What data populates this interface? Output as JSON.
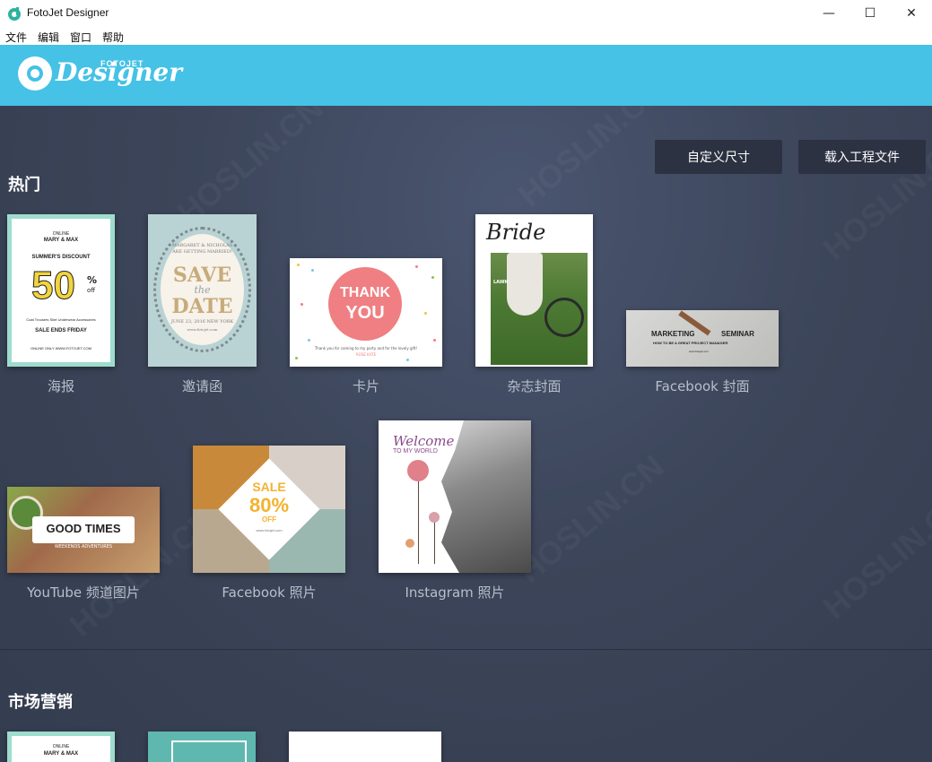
{
  "window": {
    "title": "FotoJet Designer",
    "minimize": "—",
    "maximize": "☐",
    "close": "✕"
  },
  "menu": [
    "文件",
    "编辑",
    "窗口",
    "帮助"
  ],
  "header": {
    "logo_small": "FOTOJET",
    "logo_word": "Designer",
    "bg": "#45c2e6"
  },
  "toolbar": {
    "custom_size": "自定义尺寸",
    "load_project": "载入工程文件"
  },
  "sections": {
    "hot": "热门",
    "marketing": "市场营销"
  },
  "templates": [
    {
      "label": "海报"
    },
    {
      "label": "邀请函"
    },
    {
      "label": "卡片"
    },
    {
      "label": "杂志封面"
    },
    {
      "label": "Facebook 封面"
    },
    {
      "label": "YouTube 频道图片"
    },
    {
      "label": "Facebook 照片"
    },
    {
      "label": "Instagram 照片"
    }
  ],
  "thumbs": {
    "poster": {
      "online": "ONLINE",
      "brand": "MARY & MAX",
      "discount": "SUMMER'S DISCOUNT",
      "big": "50",
      "pct": "%",
      "off": "off",
      "items": "Coat  Trousers  Skirt  Underwear  Accessories",
      "ends": "SALE ENDS FRIDAY",
      "site": "ONLINE ONLY WWW.FOTOJET.COM"
    },
    "invite": {
      "names": "MARGARET & NICHOLAS",
      "getting": "ARE GETTING MARRIED!",
      "save": "SAVE",
      "the": "the",
      "date": "DATE",
      "when": "JUNE 23, 2016 NEW YORK",
      "site": "www.fotojet.com"
    },
    "thanks": {
      "thank": "THANK",
      "you": "YOU",
      "msg": "Thank you for coming to my party and for the lovely gift!",
      "name": "ROSE KATE"
    },
    "magazine": {
      "title": "Bride",
      "lawn": "LAWN"
    },
    "fbcover": {
      "left": "MARKETING",
      "right": "SEMINAR",
      "sub": "HOW TO BE A GREAT PROJECT MANAGER",
      "site": "www.fotojet.com"
    },
    "youtube": {
      "title": "GOOD TIMES",
      "sub": "WEEKENDS ADVENTURES"
    },
    "fbphoto": {
      "sale": "SALE",
      "pct": "80%",
      "off": "OFF",
      "site": "www.fotojet.com"
    },
    "insta": {
      "welcome": "Welcome",
      "sub": "TO MY WORLD"
    },
    "bottom": {
      "online": "ONLINE",
      "brand": "MARY & MAX"
    }
  }
}
